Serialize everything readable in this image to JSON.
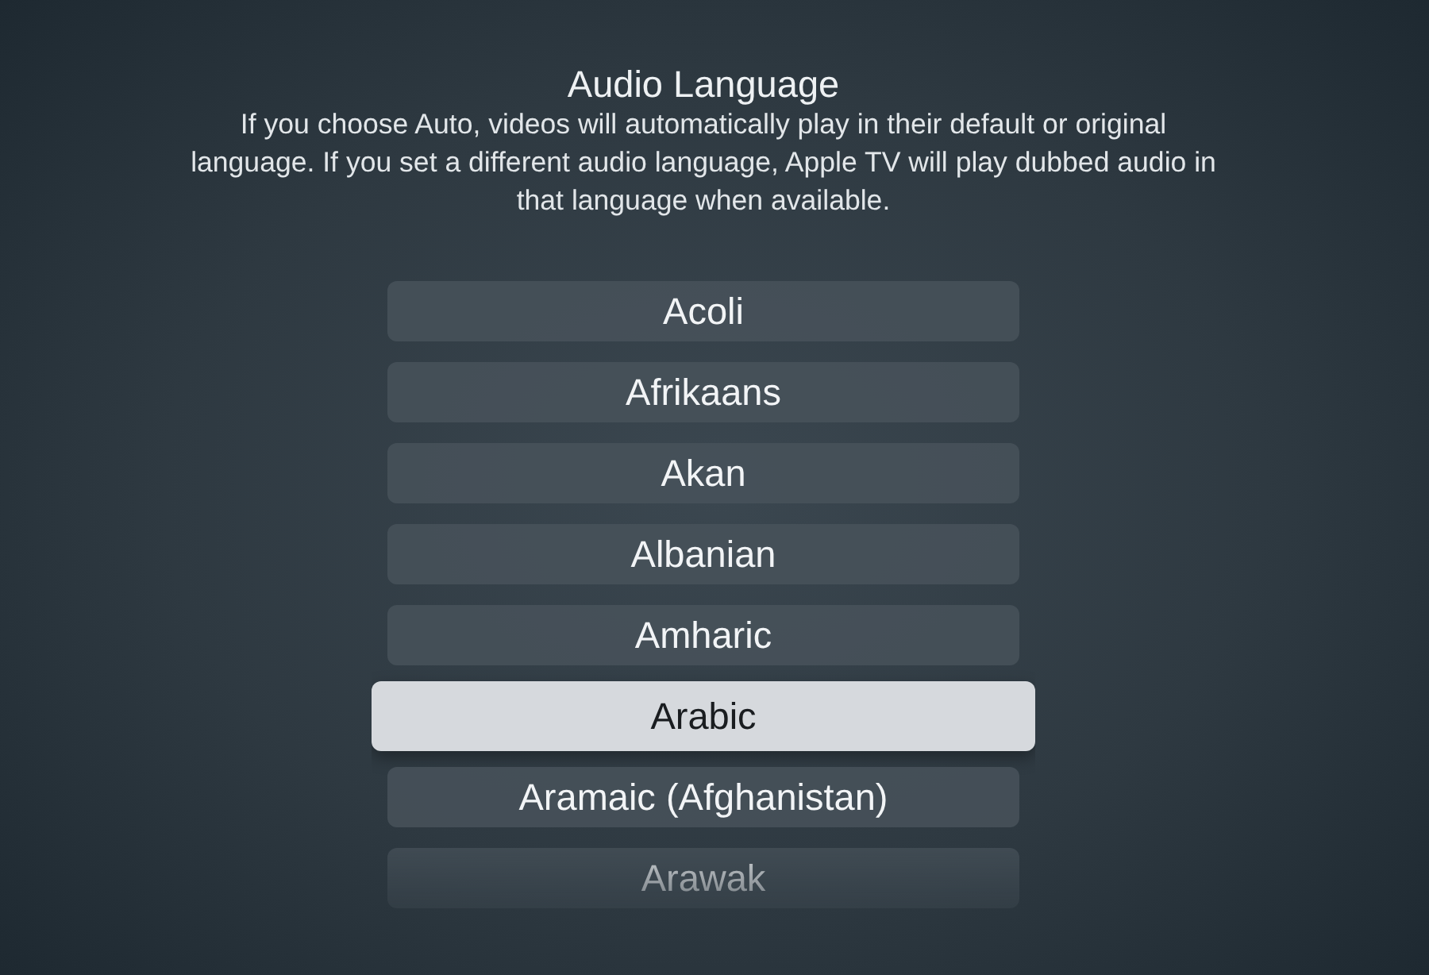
{
  "header": {
    "title": "Audio Language",
    "description": "If you choose Auto, videos will automatically play in their default or original language. If you set a different audio language, Apple TV will play dubbed audio in that language when available."
  },
  "languages": [
    {
      "label": "Acoli",
      "selected": false
    },
    {
      "label": "Afrikaans",
      "selected": false
    },
    {
      "label": "Akan",
      "selected": false
    },
    {
      "label": "Albanian",
      "selected": false
    },
    {
      "label": "Amharic",
      "selected": false
    },
    {
      "label": "Arabic",
      "selected": true
    },
    {
      "label": "Aramaic (Afghanistan)",
      "selected": false
    },
    {
      "label": "Arawak",
      "selected": false
    }
  ]
}
